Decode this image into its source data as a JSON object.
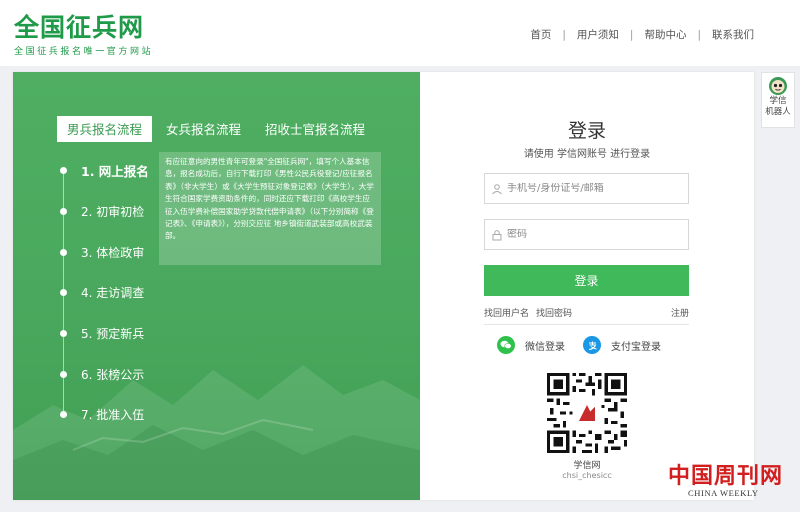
{
  "header": {
    "logo": "全国征兵网",
    "slogan": "全国征兵报名唯一官方网站",
    "nav": [
      "首页",
      "用户须知",
      "帮助中心",
      "联系我们"
    ]
  },
  "process": {
    "tabs": [
      "男兵报名流程",
      "女兵报名流程",
      "招收士官报名流程"
    ],
    "active_tab": 0,
    "steps": [
      "1. 网上报名",
      "2. 初审初检",
      "3. 体检政审",
      "4. 走访调查",
      "5. 预定新兵",
      "6. 张榜公示",
      "7. 批准入伍"
    ],
    "active_step": 0,
    "info": "有应征意向的男性青年可登录\"全国征兵网\"，填写个人基本信息，报名成功后，自行下载打印《男性公民兵役登记/应征报名表》（非大学生）或《大学生预征对象登记表》（大学生），大学生符合国家学费资助条件的，同时还应下载打印《高校学生应征入伍学费补偿国家助学贷款代偿申请表》（以下分别简称《登记表》、《申请表》），分别交应征 地乡镇街道武装部或高校武装部。"
  },
  "login": {
    "title": "登录",
    "subtitle": "请使用 学信网账号 进行登录",
    "username_placeholder": "手机号/身份证号/邮箱",
    "password_placeholder": "密码",
    "login_button": "登录",
    "find_username": "找回用户名",
    "find_password": "找回密码",
    "register": "注册",
    "wechat_login": "微信登录",
    "alipay_login": "支付宝登录",
    "qr_label": "学信网",
    "qr_id": "chsi_chesicc"
  },
  "robot": {
    "line1": "学信",
    "line2": "机器人"
  },
  "watermark": {
    "cn": "中国周刊网",
    "en": "CHINA WEEKLY"
  },
  "colors": {
    "brand": "#1f9a48",
    "panel": "#4aab5e",
    "button": "#3fb95a",
    "wechat": "#2ec24c",
    "alipay": "#1a98e6"
  }
}
